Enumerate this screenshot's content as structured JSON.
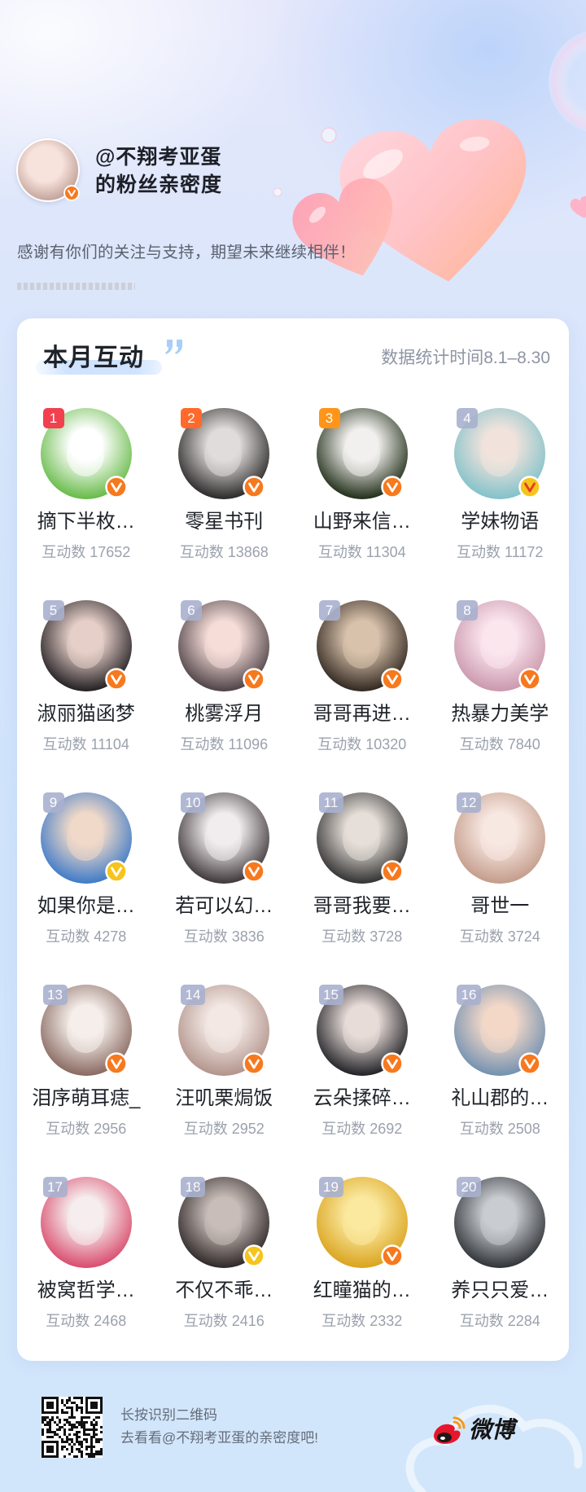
{
  "header": {
    "title_line1": "@不翔考亚蛋",
    "title_line2": "的粉丝亲密度",
    "subtitle": "感谢有你们的关注与支持，期望未来继续相伴！",
    "avatar_colors": [
      "#f8e3dc",
      "#a07b72"
    ],
    "verified_badge": "#f7791e"
  },
  "interaction": {
    "title": "本月互动",
    "period": "数据统计时间8.1–8.30",
    "fans": [
      {
        "rank": "1",
        "name": "摘下半枚…",
        "count": "互动数 17652",
        "avatar": [
          "#ffffff",
          "#63b944"
        ],
        "badge": "#f7791e"
      },
      {
        "rank": "2",
        "name": "零星书刊",
        "count": "互动数 13868",
        "avatar": [
          "#e0dcdc",
          "#262424"
        ],
        "badge": "#f7791e"
      },
      {
        "rank": "3",
        "name": "山野来信…",
        "count": "互动数 11304",
        "avatar": [
          "#f2f0ee",
          "#1c2a14"
        ],
        "badge": "#f7791e"
      },
      {
        "rank": "4",
        "name": "学妹物语",
        "count": "互动数 11172",
        "avatar": [
          "#f1e3dc",
          "#7fc1c9"
        ],
        "badge": "#f6c41b",
        "badge_mark": "#e23a2a"
      },
      {
        "rank": "5",
        "name": "淑丽猫函梦",
        "count": "互动数 11104",
        "avatar": [
          "#e6cfc8",
          "#1e1b1f"
        ],
        "badge": "#f7791e"
      },
      {
        "rank": "6",
        "name": "桃雾浮月",
        "count": "互动数 11096",
        "avatar": [
          "#f6ddd8",
          "#4a3e43"
        ],
        "badge": "#f7791e"
      },
      {
        "rank": "7",
        "name": "哥哥再进…",
        "count": "互动数 10320",
        "avatar": [
          "#d8c2ac",
          "#2e241d"
        ],
        "badge": "#f7791e"
      },
      {
        "rank": "8",
        "name": "热暴力美学",
        "count": "互动数 7840",
        "avatar": [
          "#fbe6ee",
          "#c996ab"
        ],
        "badge": "#f7791e"
      },
      {
        "rank": "9",
        "name": "如果你是…",
        "count": "互动数 4278",
        "avatar": [
          "#f0d9c8",
          "#3a78c8"
        ],
        "badge": "#f6c41b"
      },
      {
        "rank": "10",
        "name": "若可以幻…",
        "count": "互动数 3836",
        "avatar": [
          "#f1ecee",
          "#3a3335"
        ],
        "badge": "#f7791e"
      },
      {
        "rank": "11",
        "name": "哥哥我要…",
        "count": "互动数 3728",
        "avatar": [
          "#e6dfd9",
          "#2e2e2e"
        ],
        "badge": "#f7791e"
      },
      {
        "rank": "12",
        "name": "哥世一",
        "count": "互动数 3724",
        "avatar": [
          "#f8e8e2",
          "#c29a88"
        ]
      },
      {
        "rank": "13",
        "name": "泪序萌耳痣_",
        "count": "互动数 2956",
        "avatar": [
          "#f5eeea",
          "#86665d"
        ],
        "badge": "#f7791e"
      },
      {
        "rank": "14",
        "name": "汪叽栗焗饭",
        "count": "互动数 2952",
        "avatar": [
          "#f3e8e3",
          "#b0928a"
        ],
        "badge": "#f7791e"
      },
      {
        "rank": "15",
        "name": "云朵揉碎…",
        "count": "互动数 2692",
        "avatar": [
          "#e8dcd8",
          "#1c1d22"
        ],
        "badge": "#f7791e"
      },
      {
        "rank": "16",
        "name": "礼山郡的…",
        "count": "互动数 2508",
        "avatar": [
          "#f3d8c8",
          "#6f8fb0"
        ],
        "badge": "#f7791e"
      },
      {
        "rank": "17",
        "name": "被窝哲学…",
        "count": "互动数 2468",
        "avatar": [
          "#f6eeee",
          "#d8486a"
        ]
      },
      {
        "rank": "18",
        "name": "不仅不乖…",
        "count": "互动数 2416",
        "avatar": [
          "#c9bdb9",
          "#2a2424"
        ],
        "badge": "#f6c41b"
      },
      {
        "rank": "19",
        "name": "红瞳猫的…",
        "count": "互动数 2332",
        "avatar": [
          "#fbe9a0",
          "#d9a21b"
        ],
        "badge": "#f7791e"
      },
      {
        "rank": "20",
        "name": "养只只爱…",
        "count": "互动数 2284",
        "avatar": [
          "#c9ccd0",
          "#2c2f33"
        ]
      }
    ]
  },
  "footer": {
    "qr_hint": "长按识别二维码",
    "cta": "去看看@不翔考亚蛋的亲密度吧!",
    "brand": "微博"
  },
  "colors": {
    "rank_1": "#f2404f",
    "rank_2": "#ff6a2c",
    "rank_3": "#ff9519",
    "rank_default": "#a9b1cf",
    "badge_mark_default": "#ffffff",
    "weibo_red": "#e6162d",
    "weibo_orange": "#f39a1b"
  }
}
